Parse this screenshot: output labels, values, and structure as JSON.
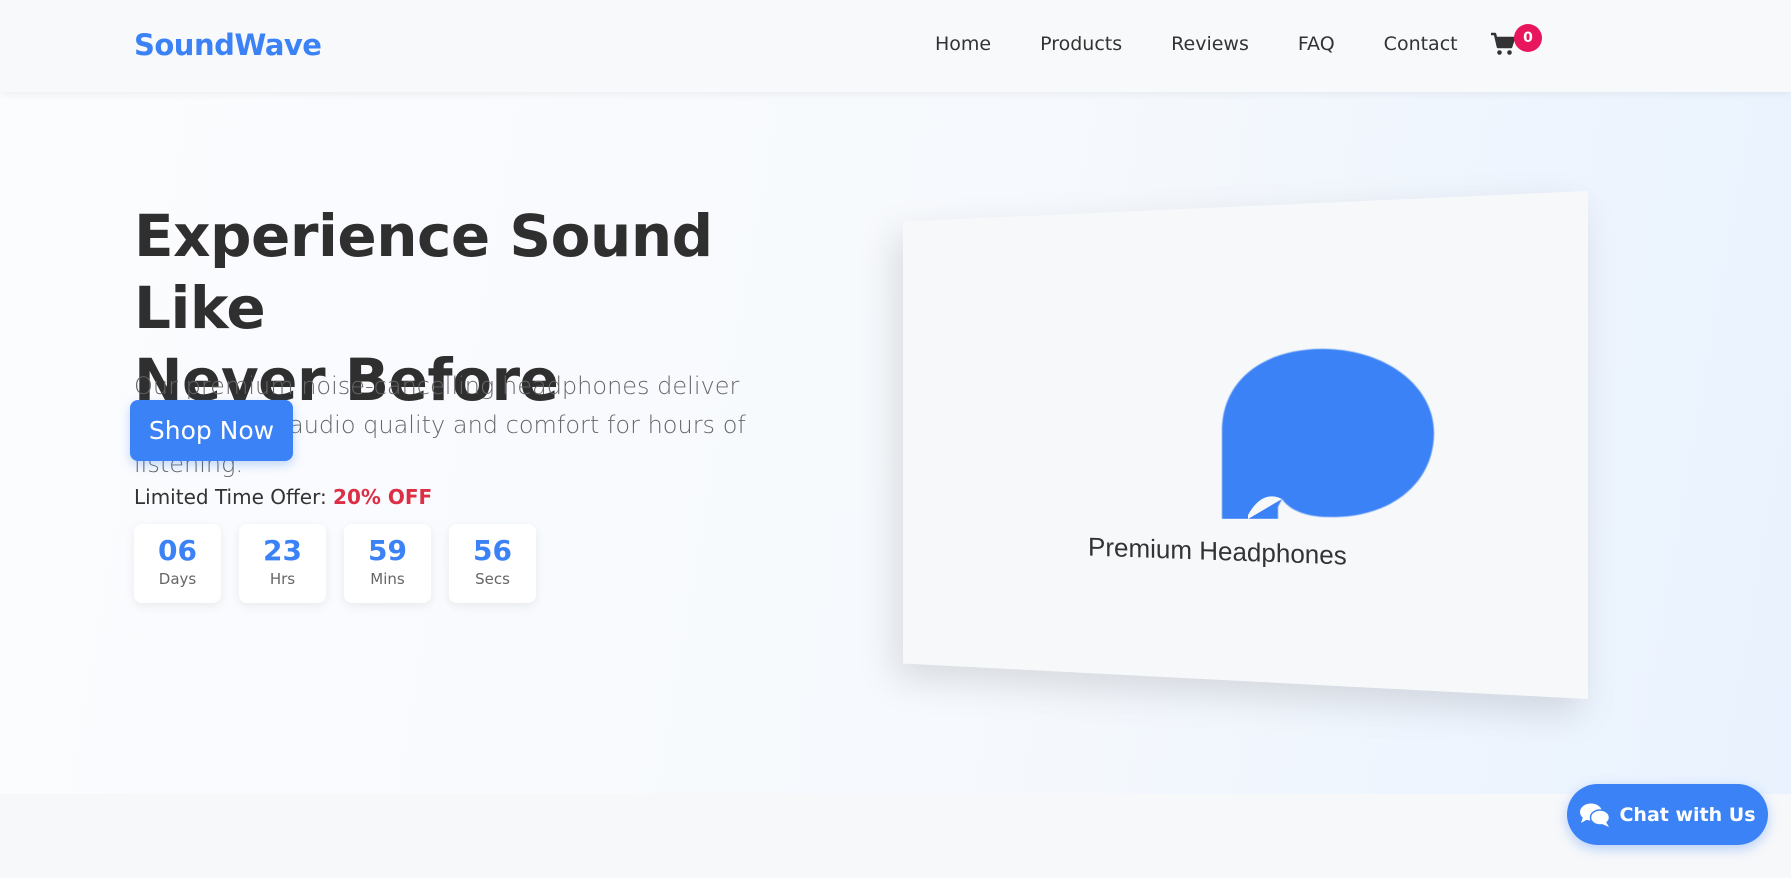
{
  "header": {
    "logo": "SoundWave",
    "nav": [
      "Home",
      "Products",
      "Reviews",
      "FAQ",
      "Contact"
    ],
    "cart_count": "0"
  },
  "hero": {
    "title_line1": "Experience Sound Like",
    "title_line2": "Never Before",
    "subtitle": "Our premium noise-cancelling headphones deliver crystal clear audio quality and comfort for hours of listening.",
    "cta": "Shop Now",
    "offer_label": "Limited Time Offer:",
    "offer_value": "20% OFF",
    "countdown": [
      {
        "value": "06",
        "label": "Days"
      },
      {
        "value": "23",
        "label": "Hrs"
      },
      {
        "value": "59",
        "label": "Mins"
      },
      {
        "value": "56",
        "label": "Secs"
      }
    ],
    "product_label": "Premium Headphones"
  },
  "chat": {
    "label": "Chat with Us"
  },
  "colors": {
    "accent": "#3b82f6",
    "badge": "#e8175d",
    "offer": "#dc2f45"
  },
  "icons": {
    "cart": "cart-icon",
    "chat": "chat-bubbles-icon"
  }
}
